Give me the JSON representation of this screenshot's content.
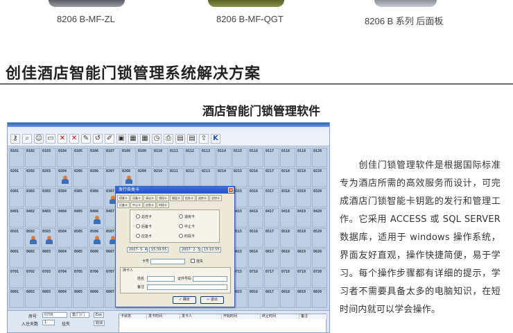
{
  "products": [
    {
      "caption": "8206 B-MF-ZL"
    },
    {
      "caption": "8206 B-MF-QGT"
    },
    {
      "caption": "8206 B 系列 后面板"
    }
  ],
  "section_title": "创佳酒店智能门锁管理系统解决方案",
  "sub_title": "酒店智能门锁管理软件",
  "description": "　　创佳门锁管理软件是根据国际标准专为酒店所需的高效服务而设计，可完成酒店门锁智能卡钥匙的发行和管理工作。它采用 ACCESS 或 SQL SERVER 数据库，适用于 windows 操作系统，界面友好直观，操作快捷简便，易于学习。每个操作步骤都有详细的提示，学习者不需要具备太多的电脑知识，在短时间内就可以学会操作。",
  "software": {
    "toolbar_icons": [
      "key-icon",
      "search-icon",
      "user-icon",
      "card-icon",
      "x-icon",
      "x-icon",
      "pen-icon",
      "arrow-icon",
      "edit-icon",
      "monitor-icon",
      "grid-icon",
      "grid-icon",
      "clock-icon",
      "printer-icon",
      "doc-icon",
      "doc-icon",
      "upload-icon",
      "k-icon"
    ],
    "floors": [
      [
        "0101",
        "0102",
        "0103",
        "0104",
        "0105",
        "0106",
        "0107",
        "0108",
        "0109",
        "0110",
        "0111",
        "0112",
        "0113",
        "0114",
        "0115",
        "0116",
        "0117",
        "0118",
        "0119",
        "0120"
      ],
      [
        "0201",
        "0202",
        "0203",
        "0204",
        "0205",
        "0206",
        "0207",
        "0208",
        "0209",
        "0210",
        "0211",
        "0212",
        "0213",
        "0214",
        "0215",
        "0216",
        "0217",
        "0218",
        "0219",
        "0220"
      ],
      [
        "0301",
        "0302",
        "0303",
        "0304",
        "0305",
        "0306",
        "0307",
        "0308",
        "0309",
        "0310",
        "0311",
        "0312",
        "0313",
        "0314",
        "0315",
        "0316",
        "0317",
        "0318",
        "0319",
        "0320"
      ],
      [
        "0401",
        "0402",
        "0403",
        "0404",
        "0405",
        "0406",
        "0407",
        "0408",
        "0409",
        "0410",
        "0411",
        "0412",
        "0413",
        "0414",
        "0415",
        "0416",
        "0417",
        "0418",
        "0419",
        "0420"
      ],
      [
        "0501",
        "0502",
        "0503",
        "0504",
        "0505",
        "0506",
        "0507",
        "0508",
        "0509",
        "0510",
        "0511",
        "0512",
        "0513",
        "0514",
        "0515",
        "0516",
        "0517",
        "0518",
        "0519",
        "0520"
      ],
      [
        "0601",
        "0602",
        "0603",
        "0604",
        "0605",
        "0606",
        "0607",
        "0608",
        "0609",
        "0610",
        "0611",
        "0612",
        "0613",
        "0614",
        "0615",
        "0616",
        "0617",
        "0618",
        "0619",
        "0620"
      ],
      [
        "0701",
        "0702",
        "0703",
        "0704",
        "0705",
        "0706",
        "0707",
        "0708",
        "0709",
        "0710",
        "0711",
        "0712",
        "0713",
        "0714",
        "0715",
        "0716",
        "0717",
        "0718",
        "0719",
        "0720"
      ],
      [
        "0801",
        "0802",
        "0803",
        "0804",
        "0805",
        "0806",
        "0807",
        "0808",
        "0809",
        "0810",
        "0811",
        "0812",
        "0813",
        "0814",
        "0815",
        "0816",
        "0817",
        "0818",
        "0819",
        "0820"
      ]
    ],
    "occupied": [
      "0204",
      "0307",
      "0208",
      "0406",
      "0502",
      "0503",
      "0506",
      "0507"
    ],
    "dialog": {
      "title": "发行各类卡",
      "close": "×",
      "tabs": [
        "宿客卡",
        "设备卡",
        "清洁卡",
        "领班卡",
        "楼层卡",
        "挂失卡",
        "退房卡",
        "总控卡",
        "后备卡",
        "中止卡",
        "应急卡",
        "时段卡"
      ],
      "radios": [
        "总控卡",
        "退房卡",
        "后备卡",
        "中止卡",
        "应急卡",
        "时段卡"
      ],
      "date_start": "2007- 5- 4",
      "time_start": "15:39:55",
      "date_end": "2007- 2- 3",
      "time_end": "15:10:55",
      "card_label": "卡号",
      "lost_label": "挂失",
      "holder_label": "持卡人",
      "name_label": "姓名",
      "id_label": "证件号码",
      "remark_label": "备注",
      "ok": "确定",
      "exit": "退出"
    },
    "bottom": {
      "room_label": "房号",
      "room_value": "0706",
      "type_value": "套/门/门",
      "days_label": "入住天数",
      "days_value": "1",
      "lost_label": "挂失",
      "btn1": "Exe",
      "btn2": "取消",
      "cols": [
        "卡状态",
        "发卡时间",
        "发卡人",
        "开始时间",
        "终止时间",
        "备注"
      ]
    }
  }
}
